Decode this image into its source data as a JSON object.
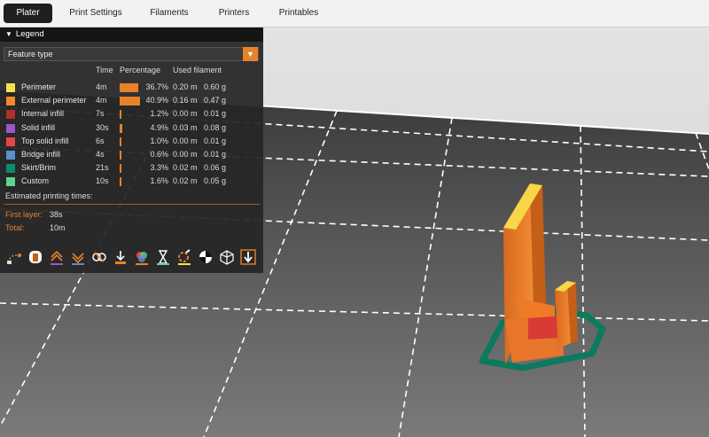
{
  "tabs": [
    "Plater",
    "Print Settings",
    "Filaments",
    "Printers",
    "Printables"
  ],
  "legend": {
    "title": "Legend",
    "view_type": "Feature type",
    "columns": {
      "time": "Time",
      "percentage": "Percentage",
      "used_filament": "Used filament"
    },
    "rows": [
      {
        "name": "Perimeter",
        "time": "4m",
        "percentage": "36.7%",
        "percent_value": 36.7,
        "meters": "0.20 m",
        "grams": "0.60 g",
        "color": "#f7e14a"
      },
      {
        "name": "External perimeter",
        "time": "4m",
        "percentage": "40.9%",
        "percent_value": 40.9,
        "meters": "0.16 m",
        "grams": "0.47 g",
        "color": "#f08a2a"
      },
      {
        "name": "Internal infill",
        "time": "7s",
        "percentage": "1.2%",
        "percent_value": 1.2,
        "meters": "0.00 m",
        "grams": "0.01 g",
        "color": "#b0302c"
      },
      {
        "name": "Solid infill",
        "time": "30s",
        "percentage": "4.9%",
        "percent_value": 4.9,
        "meters": "0.03 m",
        "grams": "0.08 g",
        "color": "#9b57c8"
      },
      {
        "name": "Top solid infill",
        "time": "6s",
        "percentage": "1.0%",
        "percent_value": 1.0,
        "meters": "0.00 m",
        "grams": "0.01 g",
        "color": "#e8434a"
      },
      {
        "name": "Bridge infill",
        "time": "4s",
        "percentage": "0.6%",
        "percent_value": 0.6,
        "meters": "0.00 m",
        "grams": "0.01 g",
        "color": "#5b8fd0"
      },
      {
        "name": "Skirt/Brim",
        "time": "21s",
        "percentage": "3.3%",
        "percent_value": 3.3,
        "meters": "0.02 m",
        "grams": "0.06 g",
        "color": "#0e8a6c"
      },
      {
        "name": "Custom",
        "time": "10s",
        "percentage": "1.6%",
        "percent_value": 1.6,
        "meters": "0.02 m",
        "grams": "0.05 g",
        "color": "#5fd48f"
      }
    ],
    "estimated_label": "Estimated printing times:",
    "first_layer_label": "First layer:",
    "first_layer_value": "38s",
    "total_label": "Total:",
    "total_value": "10m",
    "view_icons": [
      "travel-icon",
      "wipe-icon",
      "retractions-icon",
      "deretractions-icon",
      "seams-icon",
      "tool-changes-icon",
      "color-changes-icon",
      "pause-prints-icon",
      "custom-gcodes-icon",
      "center-of-gravity-icon",
      "shells-icon",
      "tool-marker-icon"
    ]
  },
  "colors": {
    "accent": "#e8822a",
    "bed": "#5e5e5e",
    "model_orange": "#ee7a26",
    "skirt_green": "#0b7a5e"
  }
}
